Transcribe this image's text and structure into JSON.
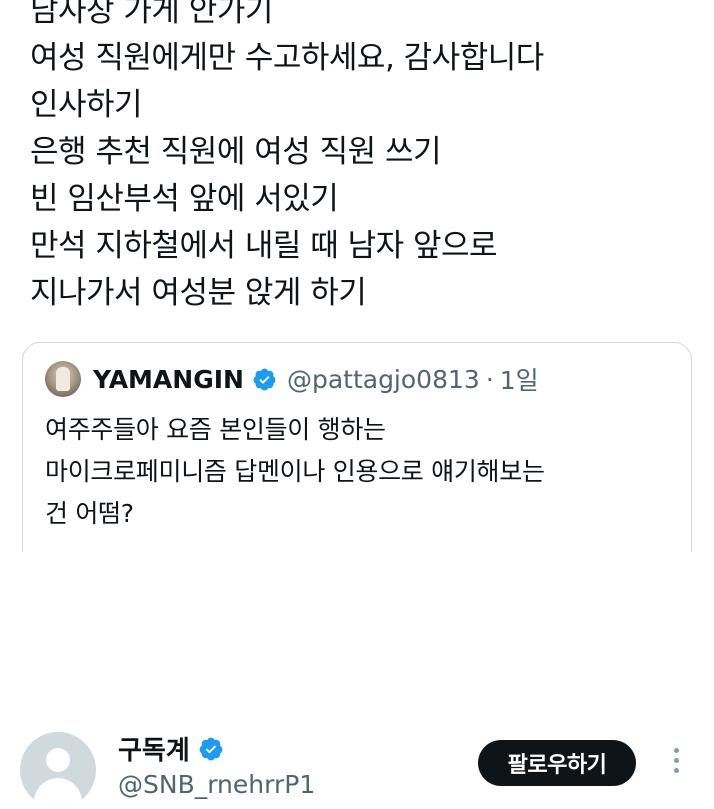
{
  "tweet": {
    "lines": [
      "남사장 가게 안가기",
      "여성 직원에게만 수고하세요, 감사합니다",
      "인사하기",
      "은행 추천 직원에 여성 직원 쓰기",
      "빈 임산부석 앞에 서있기",
      "만석 지하철에서 내릴 때 남자 앞으로",
      "지나가서 여성분 앉게 하기"
    ]
  },
  "quote": {
    "name": "YAMANGIN",
    "handle": "@pattagjo0813",
    "separator": "·",
    "time": "1일",
    "text_lines": [
      "여주주들아 요즘 본인들이 행하는",
      "마이크로페미니즘 답멘이나 인용으로 얘기해보는",
      "건 어떰?"
    ],
    "verified_color": "#1d9bf0"
  },
  "account": {
    "name": "구독계",
    "handle": "@SNB_rnehrrP1",
    "follow_label": "팔로우하기",
    "avatar_color": "#cfd9de"
  },
  "icons": {
    "verified": "verified-badge-icon",
    "more": "more-vertical-icon"
  }
}
